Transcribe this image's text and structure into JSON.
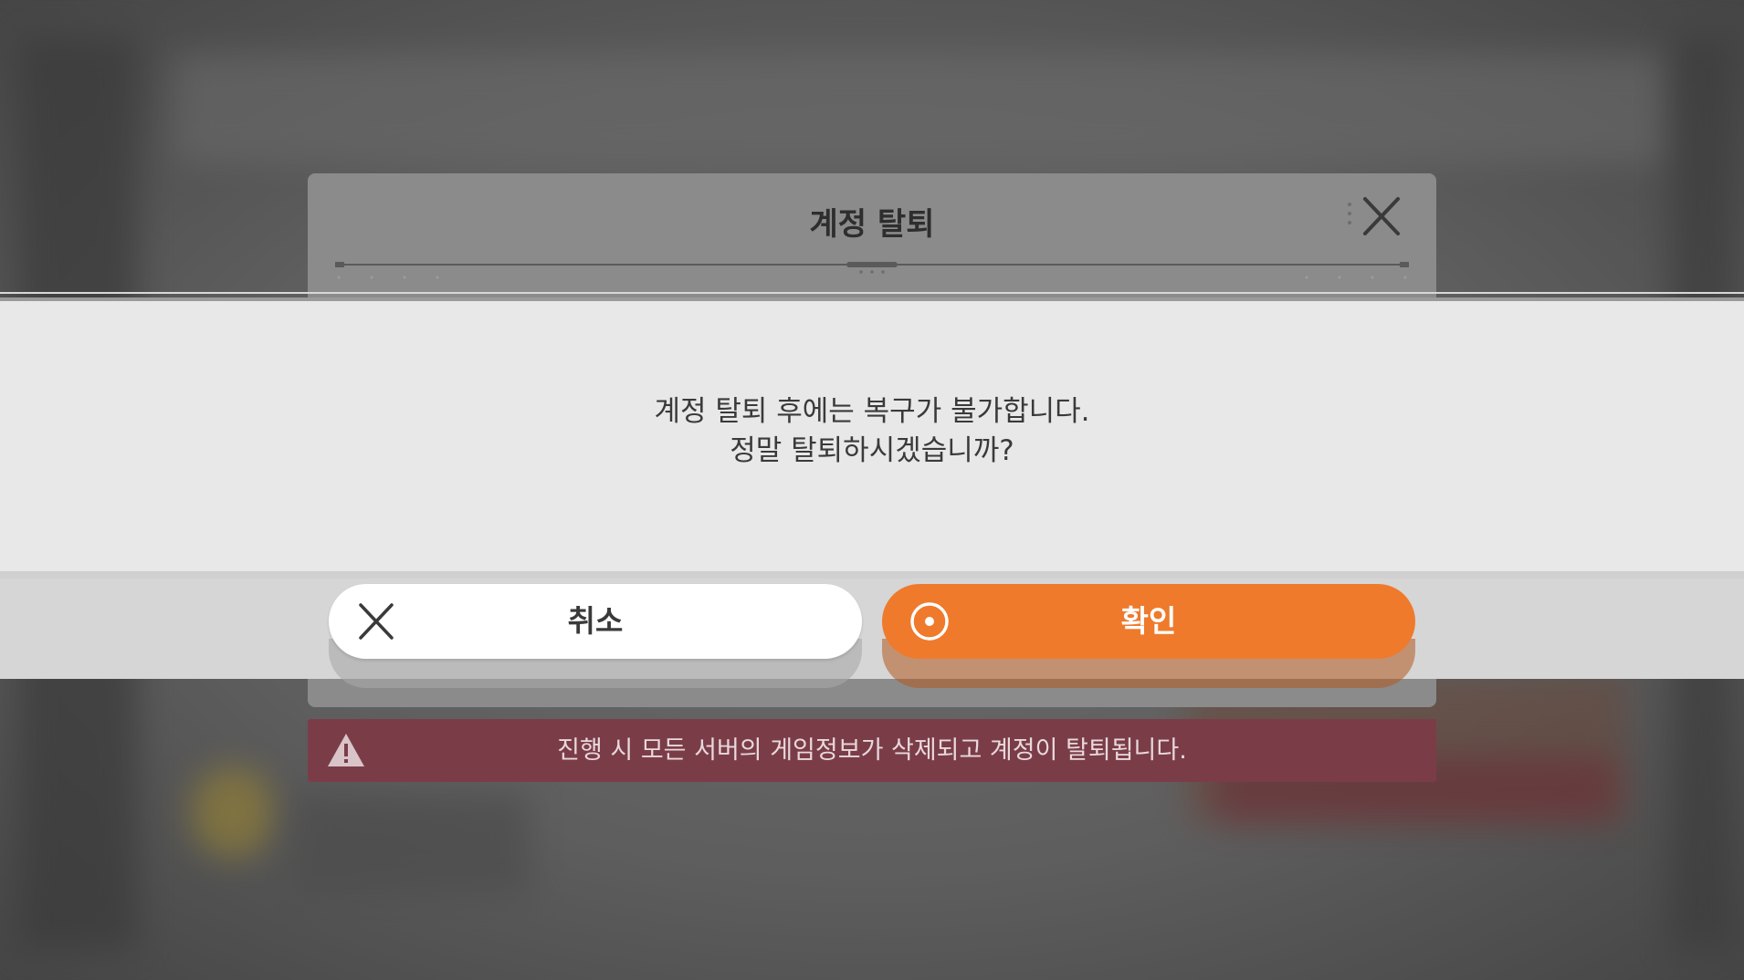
{
  "dialog": {
    "title": "계정 탈퇴",
    "close_icon": "close-icon",
    "message_lines": [
      "계정 탈퇴 후에는 복구가 불가합니다.",
      "정말 탈퇴하시겠습니까?"
    ]
  },
  "buttons": {
    "cancel": {
      "label": "취소",
      "icon": "close-icon"
    },
    "confirm": {
      "label": "확인",
      "icon": "radio-dot-icon"
    }
  },
  "warning": {
    "icon": "warning-triangle-icon",
    "text": "진행 시 모든 서버의 게임정보가 삭제되고 계정이 탈퇴됩니다."
  },
  "colors": {
    "confirm_button": "#ef7a2c",
    "cancel_button": "#ffffff",
    "warning_bar": "#7a3d48",
    "dialog_header": "#8b8b8b"
  }
}
